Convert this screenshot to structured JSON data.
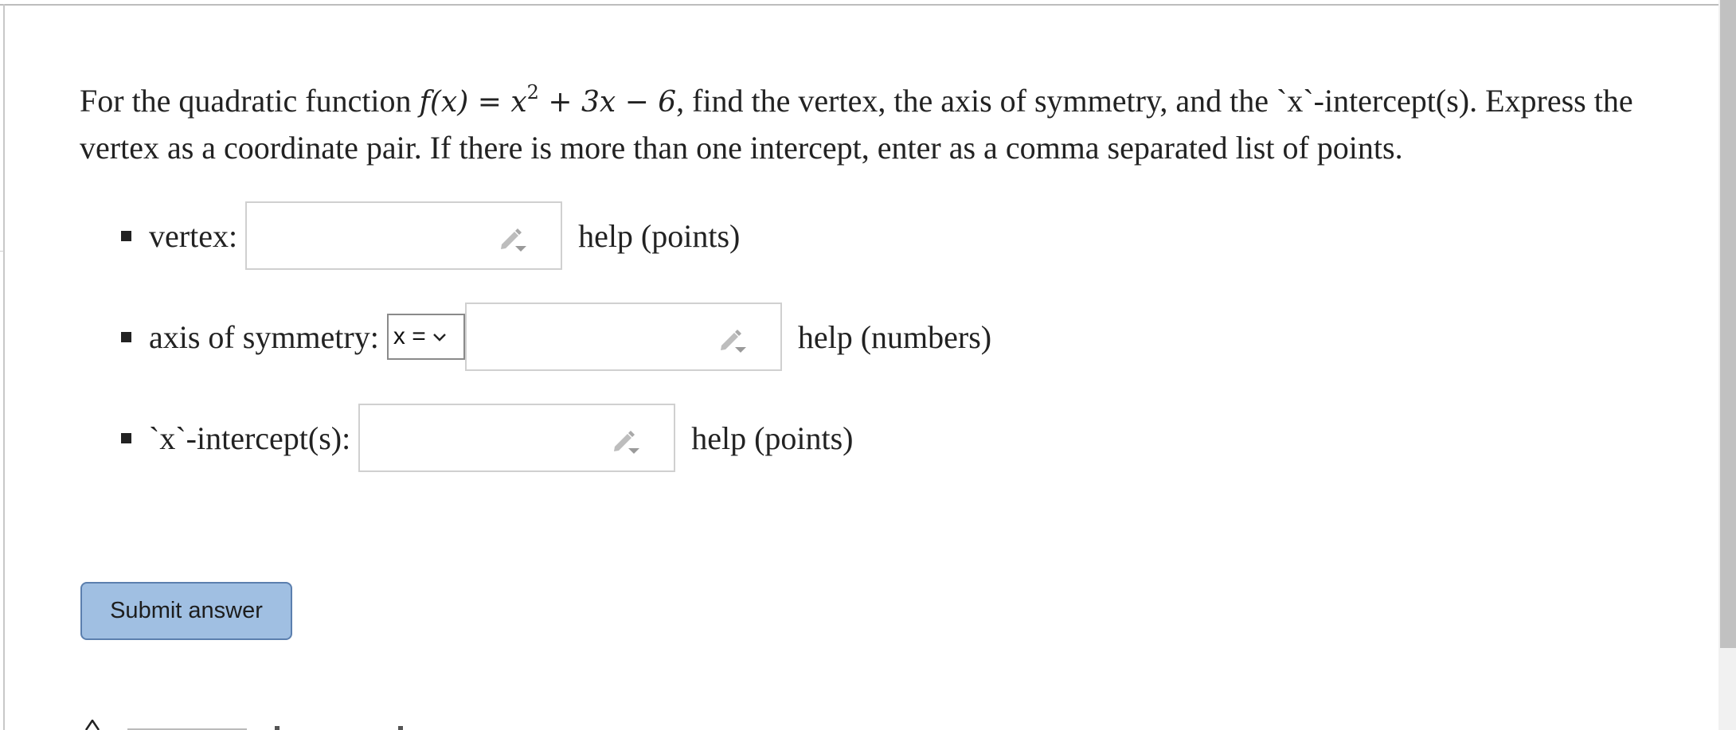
{
  "problem": {
    "text_before": "For the quadratic function ",
    "math_fx": "f",
    "math_paren": "(x) = x",
    "math_exp": "2",
    "math_rest": " + 3x − 6",
    "text_after": ", find the vertex, the axis of symmetry, and the `x`-intercept(s). Express the vertex as a coordinate pair. If there is more than one intercept, enter as a comma separated list of points."
  },
  "fields": {
    "vertex": {
      "label": "vertex:",
      "value": "",
      "help": "help (points)"
    },
    "axis": {
      "label": "axis of symmetry:",
      "select_value": "x =",
      "value": "",
      "help": "help (numbers)"
    },
    "intercepts": {
      "label": "`x`-intercept(s):",
      "value": "",
      "help": "help (points)"
    }
  },
  "submit_label": "Submit answer",
  "colors": {
    "submit_bg": "#a0bfe2",
    "submit_border": "#5b7fae",
    "field_border": "#d0d0d0",
    "scrollbar": "#c1c1c1"
  },
  "icons": {
    "field_action": "pencil-dropdown-icon",
    "select": "chevron-down-icon"
  }
}
